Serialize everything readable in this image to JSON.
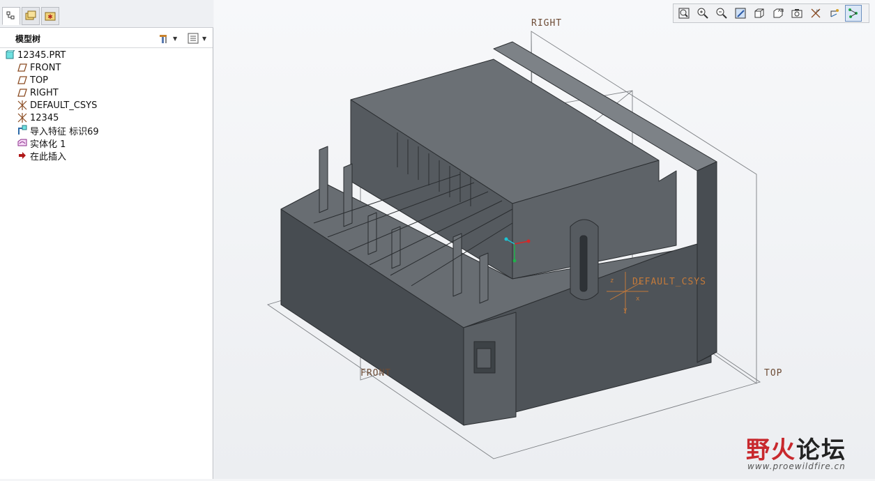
{
  "panel": {
    "tabs": [
      {
        "name": "model-tree-tab",
        "active": true
      },
      {
        "name": "folder-browser-tab",
        "active": false
      },
      {
        "name": "favorites-tab",
        "active": false
      }
    ],
    "title": "模型树",
    "settings_icon": "tree-settings-icon",
    "columns_icon": "tree-columns-icon"
  },
  "tree": {
    "items": [
      {
        "label": "12345.PRT",
        "icon": "part-icon"
      },
      {
        "label": "FRONT",
        "icon": "datum-plane-icon"
      },
      {
        "label": "TOP",
        "icon": "datum-plane-icon"
      },
      {
        "label": "RIGHT",
        "icon": "datum-plane-icon"
      },
      {
        "label": "DEFAULT_CSYS",
        "icon": "csys-icon"
      },
      {
        "label": "12345",
        "icon": "csys-icon"
      },
      {
        "label": "导入特征 标识69",
        "icon": "import-feature-icon"
      },
      {
        "label": "实体化 1",
        "icon": "solidify-icon"
      },
      {
        "label": "在此插入",
        "icon": "insert-here-icon"
      }
    ]
  },
  "toolbar": {
    "buttons": [
      "refit-icon",
      "zoom-in-icon",
      "zoom-out-icon",
      "repaint-icon",
      "display-style-icon",
      "saved-views-icon",
      "view-manager-icon",
      "datum-display-icon",
      "spin-center-icon",
      "annotation-display-icon"
    ],
    "active": "annotation-display-icon"
  },
  "viewport": {
    "plane_labels": {
      "right": "RIGHT",
      "front": "FRONT",
      "top": "TOP",
      "csys": "DEFAULT_CSYS"
    },
    "csys_axes": [
      "x",
      "y",
      "z"
    ]
  },
  "watermark": {
    "brand_first": "野火",
    "brand_rest": "论坛",
    "url": "www.proewildfire.cn"
  },
  "colors": {
    "model_dark": "#4b5055",
    "model_mid": "#5d6267",
    "model_light": "#7a7f84",
    "datum": "#6d4c36",
    "watermark_red": "#c8282d"
  }
}
